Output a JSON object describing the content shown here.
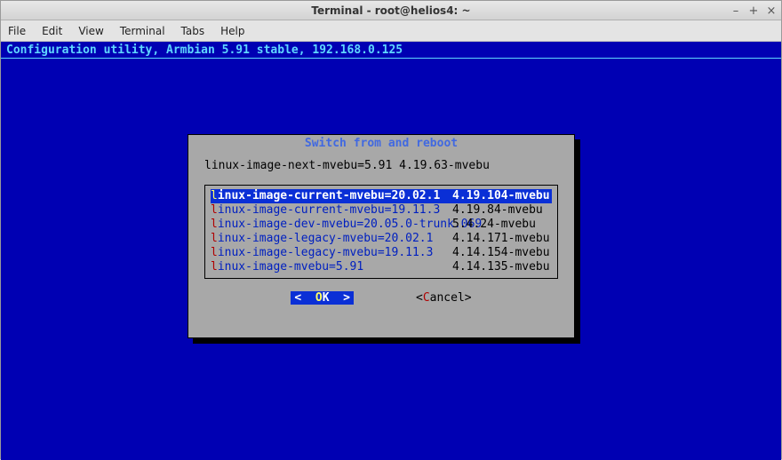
{
  "window": {
    "title": "Terminal - root@helios4: ~",
    "min": "–",
    "max": "+",
    "close": "×"
  },
  "menu": {
    "file": "File",
    "edit": "Edit",
    "view": "View",
    "terminal": "Terminal",
    "tabs": "Tabs",
    "help": "Help"
  },
  "term": {
    "header": "Configuration utility, Armbian 5.91 stable, 192.168.0.125"
  },
  "dialog": {
    "title": "Switch from and reboot",
    "current": "linux-image-next-mvebu=5.91 4.19.63-mvebu",
    "items": [
      {
        "first": "l",
        "rest": "inux-image-current-mvebu=20.02.1",
        "ver": "4.19.104-mvebu",
        "selected": true
      },
      {
        "first": "l",
        "rest": "inux-image-current-mvebu=19.11.3",
        "ver": "4.19.84-mvebu",
        "selected": false
      },
      {
        "first": "l",
        "rest": "inux-image-dev-mvebu=20.05.0-trunk.069",
        "ver": "5.4.24-mvebu",
        "selected": false
      },
      {
        "first": "l",
        "rest": "inux-image-legacy-mvebu=20.02.1",
        "ver": "4.14.171-mvebu",
        "selected": false
      },
      {
        "first": "l",
        "rest": "inux-image-legacy-mvebu=19.11.3",
        "ver": "4.14.154-mvebu",
        "selected": false
      },
      {
        "first": "l",
        "rest": "inux-image-mvebu=5.91",
        "ver": "4.14.135-mvebu",
        "selected": false
      }
    ],
    "ok_left": "<  ",
    "ok_hot": "O",
    "ok_rest": "K  >",
    "cancel_left": "<",
    "cancel_hot": "C",
    "cancel_rest": "ancel>"
  }
}
